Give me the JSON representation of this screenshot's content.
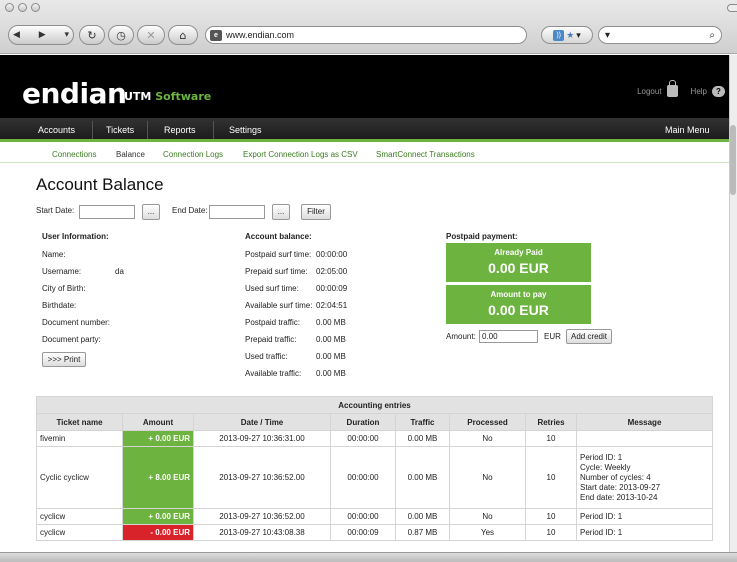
{
  "browser": {
    "url": "www.endian.com"
  },
  "brand": {
    "logo": "endian",
    "product": "UTM",
    "product_suffix": "Software"
  },
  "header_links": {
    "logout": "Logout",
    "help": "Help"
  },
  "main_nav": {
    "items": [
      "Accounts",
      "Tickets",
      "Reports",
      "Settings"
    ],
    "right": "Main Menu"
  },
  "sub_nav": {
    "items": [
      "Connections",
      "Balance",
      "Connection Logs",
      "Export Connection Logs as CSV",
      "SmartConnect Transactions"
    ],
    "current": "Balance"
  },
  "page": {
    "title": "Account Balance"
  },
  "filter": {
    "start_label": "Start Date:",
    "end_label": "End Date:",
    "picker_label": "...",
    "button": "Filter"
  },
  "user_info": {
    "heading": "User Information:",
    "name_label": "Name:",
    "username_label": "Username:",
    "username_value": "da",
    "city_label": "City of Birth:",
    "birthdate_label": "Birthdate:",
    "docnum_label": "Document number:",
    "docparty_label": "Document party:",
    "print_button": ">>> Print"
  },
  "balance": {
    "heading": "Account balance:",
    "rows": [
      {
        "label": "Postpaid surf time:",
        "value": "00:00:00"
      },
      {
        "label": "Prepaid surf time:",
        "value": "02:05:00"
      },
      {
        "label": "Used surf time:",
        "value": "00:00:09"
      },
      {
        "label": "Available surf time:",
        "value": "02:04:51"
      },
      {
        "label": "Postpaid traffic:",
        "value": "0.00 MB"
      },
      {
        "label": "Prepaid traffic:",
        "value": "0.00 MB"
      },
      {
        "label": "Used traffic:",
        "value": "0.00 MB"
      },
      {
        "label": "Available traffic:",
        "value": "0.00 MB"
      }
    ]
  },
  "postpaid": {
    "heading": "Postpaid payment:",
    "paid_title": "Already Paid",
    "paid_value": "0.00 EUR",
    "topay_title": "Amount to pay",
    "topay_value": "0.00 EUR",
    "amount_label": "Amount:",
    "amount_value": "0.00",
    "currency": "EUR",
    "add_button": "Add credit"
  },
  "accounting": {
    "caption": "Accounting entries",
    "columns": [
      "Ticket name",
      "Amount",
      "Date / Time",
      "Duration",
      "Traffic",
      "Processed",
      "Retries",
      "Message"
    ],
    "rows": [
      {
        "ticket": "fivemin",
        "amount": "+ 0.00 EUR",
        "datetime": "2013-09-27 10:36:31.00",
        "duration": "00:00:00",
        "traffic": "0.00 MB",
        "processed": "No",
        "retries": "10",
        "message": []
      },
      {
        "ticket": "Cyclic cyclicw",
        "amount": "+ 8.00 EUR",
        "datetime": "2013-09-27 10:36:52.00",
        "duration": "00:00:00",
        "traffic": "0.00 MB",
        "processed": "No",
        "retries": "10",
        "message": [
          "Period ID: 1",
          "Cycle: Weekly",
          "Number of cycles: 4",
          "Start date: 2013-09-27",
          "End date: 2013-10-24"
        ]
      },
      {
        "ticket": "cyclicw",
        "amount": "+ 0.00 EUR",
        "datetime": "2013-09-27 10:36:52.00",
        "duration": "00:00:00",
        "traffic": "0.00 MB",
        "processed": "No",
        "retries": "10",
        "message": [
          "Period ID: 1"
        ]
      },
      {
        "ticket": "cyclicw",
        "amount": "- 0.00 EUR",
        "datetime": "2013-09-27 10:43:08.38",
        "duration": "00:00:09",
        "traffic": "0.87 MB",
        "processed": "Yes",
        "retries": "10",
        "message": [
          "Period ID: 1"
        ]
      }
    ]
  },
  "colors": {
    "brand_green": "#6cb33f",
    "debit_red": "#d8232a"
  }
}
